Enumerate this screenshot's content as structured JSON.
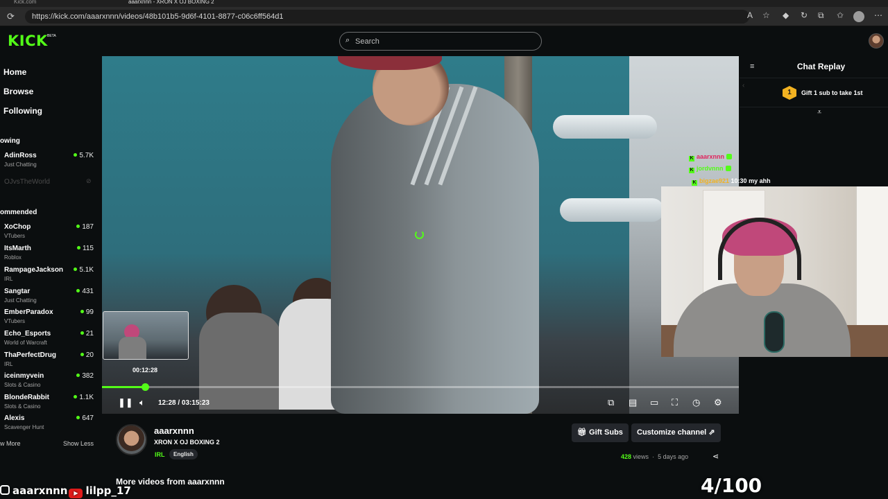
{
  "browser": {
    "tabs": [
      "Kick.com",
      "aaarxnnn - XRON X OJ BOXING 2"
    ],
    "url": "https://kick.com/aaarxnnn/videos/48b101b5-9d6f-4101-8877-c06c6ff564d1"
  },
  "header": {
    "logo": "KICK",
    "logo_badge": "BETA",
    "search_placeholder": "Search"
  },
  "sidebar": {
    "nav": [
      "Home",
      "Browse",
      "Following"
    ],
    "following_title": "owing",
    "following": [
      {
        "name": "AdinRoss",
        "category": "Just Chatting",
        "viewers": "5.7K",
        "live": true
      },
      {
        "name": "OJvsTheWorld",
        "category": "",
        "viewers": "",
        "live": false
      }
    ],
    "recommended_title": "ommended",
    "recommended": [
      {
        "name": "XoChop",
        "category": "VTubers",
        "viewers": "187"
      },
      {
        "name": "ItsMarth",
        "category": "Roblox",
        "viewers": "115"
      },
      {
        "name": "RampageJackson",
        "category": "IRL",
        "viewers": "5.1K"
      },
      {
        "name": "Sangtar",
        "category": "Just Chatting",
        "viewers": "431"
      },
      {
        "name": "EmberParadox",
        "category": "VTubers",
        "viewers": "99"
      },
      {
        "name": "Echo_Esports",
        "category": "World of Warcraft",
        "viewers": "21"
      },
      {
        "name": "ThaPerfectDrug",
        "category": "IRL",
        "viewers": "20"
      },
      {
        "name": "iceinmyvein",
        "category": "Slots & Casino",
        "viewers": "382"
      },
      {
        "name": "BlondeRabbit",
        "category": "Slots & Casino",
        "viewers": "1.1K"
      },
      {
        "name": "Alexis",
        "category": "Scavenger Hunt",
        "viewers": "647"
      }
    ],
    "show_more": "w More",
    "show_less": "Show Less"
  },
  "player": {
    "preview_time": "00:12:28",
    "current_time": "12:28",
    "separator": "/",
    "duration": "03:15:23",
    "progress": 0.067
  },
  "chat": {
    "title": "Chat Replay",
    "gift_rank": "1",
    "gift_text": "Gift 1 sub to take 1st",
    "messages": [
      {
        "user": "aaarxnnn",
        "color": "#e0245e",
        "text": ""
      },
      {
        "user": "jordvnnn",
        "color": "#53fc18",
        "text": ""
      },
      {
        "user": "bigzae921",
        "color": "#f2b221",
        "text": "10:30 my ahh"
      }
    ]
  },
  "channel": {
    "name": "aaarxnnn",
    "title": "XRON X OJ BOXING 2",
    "category": "IRL",
    "tag": "English",
    "gift_subs": "Gift Subs",
    "customize": "Customize channel",
    "views": "428",
    "views_label": "views",
    "bullet": "·",
    "posted": "5 days ago",
    "more_videos": "More videos from aaarxnnn"
  },
  "overlay": {
    "instagram": "aaarxnnn",
    "youtube": "lilpp_17",
    "counter": "4/100"
  },
  "colors": {
    "brand": "#53fc18",
    "background": "#0b0e0f",
    "button": "#24272c"
  }
}
